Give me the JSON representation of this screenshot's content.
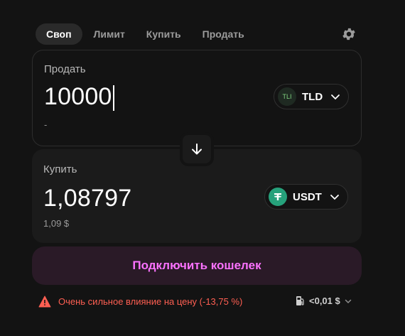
{
  "tabs": [
    {
      "label": "Своп",
      "active": true
    },
    {
      "label": "Лимит",
      "active": false
    },
    {
      "label": "Купить",
      "active": false
    },
    {
      "label": "Продать",
      "active": false
    }
  ],
  "sell": {
    "label": "Продать",
    "amount": "10000",
    "usd_value": "-",
    "token": {
      "symbol": "TLD",
      "icon_text": "TLI",
      "icon_color": "#1f2a22"
    }
  },
  "buy": {
    "label": "Купить",
    "amount": "1,08797",
    "usd_value": "1,09 $",
    "token": {
      "symbol": "USDT",
      "icon_color": "#26a17b"
    }
  },
  "connect_button": "Подключить кошелек",
  "warning": {
    "text": "Очень сильное влияние на цену (-13,75 %)",
    "color": "#ff5f52"
  },
  "gas": {
    "value": "<0,01 $"
  },
  "colors": {
    "accent": "#fc72ff",
    "background": "#131313"
  }
}
